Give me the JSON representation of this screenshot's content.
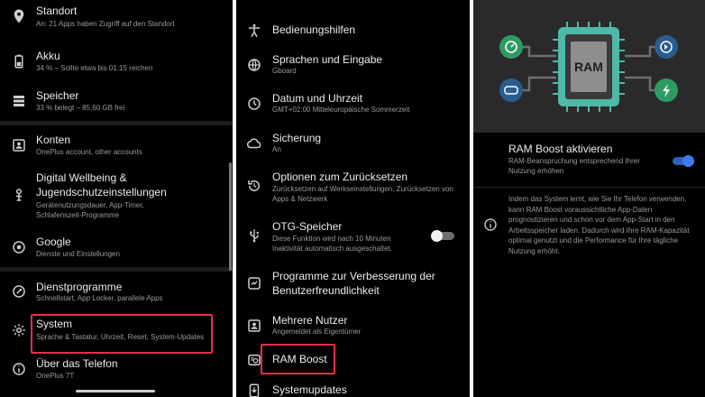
{
  "panel1": {
    "items": [
      {
        "icon": "location-pin-icon",
        "title": "Standort",
        "sub": "An: 21 Apps haben Zugriff auf den Standort"
      },
      {
        "icon": "battery-icon",
        "title": "Akku",
        "sub": "34 % – Sollte etwa bis 01:15 reichen"
      },
      {
        "icon": "storage-icon",
        "title": "Speicher",
        "sub": "33 % belegt – 85,60 GB frei"
      },
      {
        "icon": "accounts-icon",
        "title": "Konten",
        "sub": "OnePlus account, other accounts"
      },
      {
        "icon": "digital-wellbeing-icon",
        "title": "Digital Wellbeing &",
        "title2": "Jugendschutzeinstellungen",
        "sub": "Gerätenutzungsdauer, App-Timer,",
        "sub2": "Schlafenszeit-Programme"
      },
      {
        "icon": "google-icon",
        "title": "Google",
        "sub": "Dienste und Einstellungen"
      },
      {
        "icon": "utilities-icon",
        "title": "Dienstprogramme",
        "sub": "Schnellstart, App Locker, parallele Apps"
      },
      {
        "icon": "gear-icon",
        "title": "System",
        "sub": "Sprache & Tastatur, Uhrzeit, Reset, System-Updates"
      },
      {
        "icon": "info-icon",
        "title": "Über das Telefon",
        "sub": "OnePlus 7T"
      }
    ]
  },
  "panel2": {
    "items": [
      {
        "icon": "accessibility-icon",
        "title": "Bedienungshilfen"
      },
      {
        "icon": "globe-icon",
        "title": "Sprachen und Eingabe",
        "sub": "Gboard"
      },
      {
        "icon": "clock-icon",
        "title": "Datum und Uhrzeit",
        "sub": "GMT+02:00 Mitteleuropäische Sommerzeit"
      },
      {
        "icon": "backup-icon",
        "title": "Sicherung",
        "sub": "An"
      },
      {
        "icon": "reset-icon",
        "title": "Optionen zum Zurücksetzen",
        "sub": "Zurücksetzen auf Werkseinstellungen, Zurücksetzen von",
        "sub2": "Apps & Netzwerk"
      },
      {
        "icon": "usb-icon",
        "title": "OTG-Speicher",
        "sub": "Diese Funktion wird nach 10 Minuten",
        "sub2": "Inaktivität automatisch ausgeschaltet.",
        "toggle": false
      },
      {
        "icon": "feedback-icon",
        "title": "Programme zur Verbesserung der",
        "title2": "Benutzerfreundlichkeit"
      },
      {
        "icon": "multiple-users-icon",
        "title": "Mehrere Nutzer",
        "sub": "Angemeldet als Eigentümer"
      },
      {
        "icon": "ram-boost-icon",
        "title": "RAM Boost"
      },
      {
        "icon": "system-update-icon",
        "title": "Systemupdates"
      }
    ]
  },
  "panel3": {
    "illustration": {
      "chip_label": "RAM"
    },
    "setting": {
      "title": "RAM Boost aktivieren",
      "sub": "RAM-Beanspruchung entsprechend Ihrer",
      "sub2": "Nutzung erhöhen",
      "toggle": true
    },
    "description": "Indem das System lernt, wie Sie Ihr Telefon verwenden, kann RAM Boost voraussichtliche App-Daten prognostizieren und schon vor dem App-Start in den Arbeitsspeicher laden. Dadurch wird Ihre RAM-Kapazität optimal genutzt und die Performance für Ihre tägliche Nutzung erhöht."
  },
  "colors": {
    "background": "#000000",
    "highlight": "#e0304a",
    "toggle_on": "#3d7bf2",
    "chip": "#4fb8a8",
    "illustration_bg": "#2a2a2a"
  }
}
